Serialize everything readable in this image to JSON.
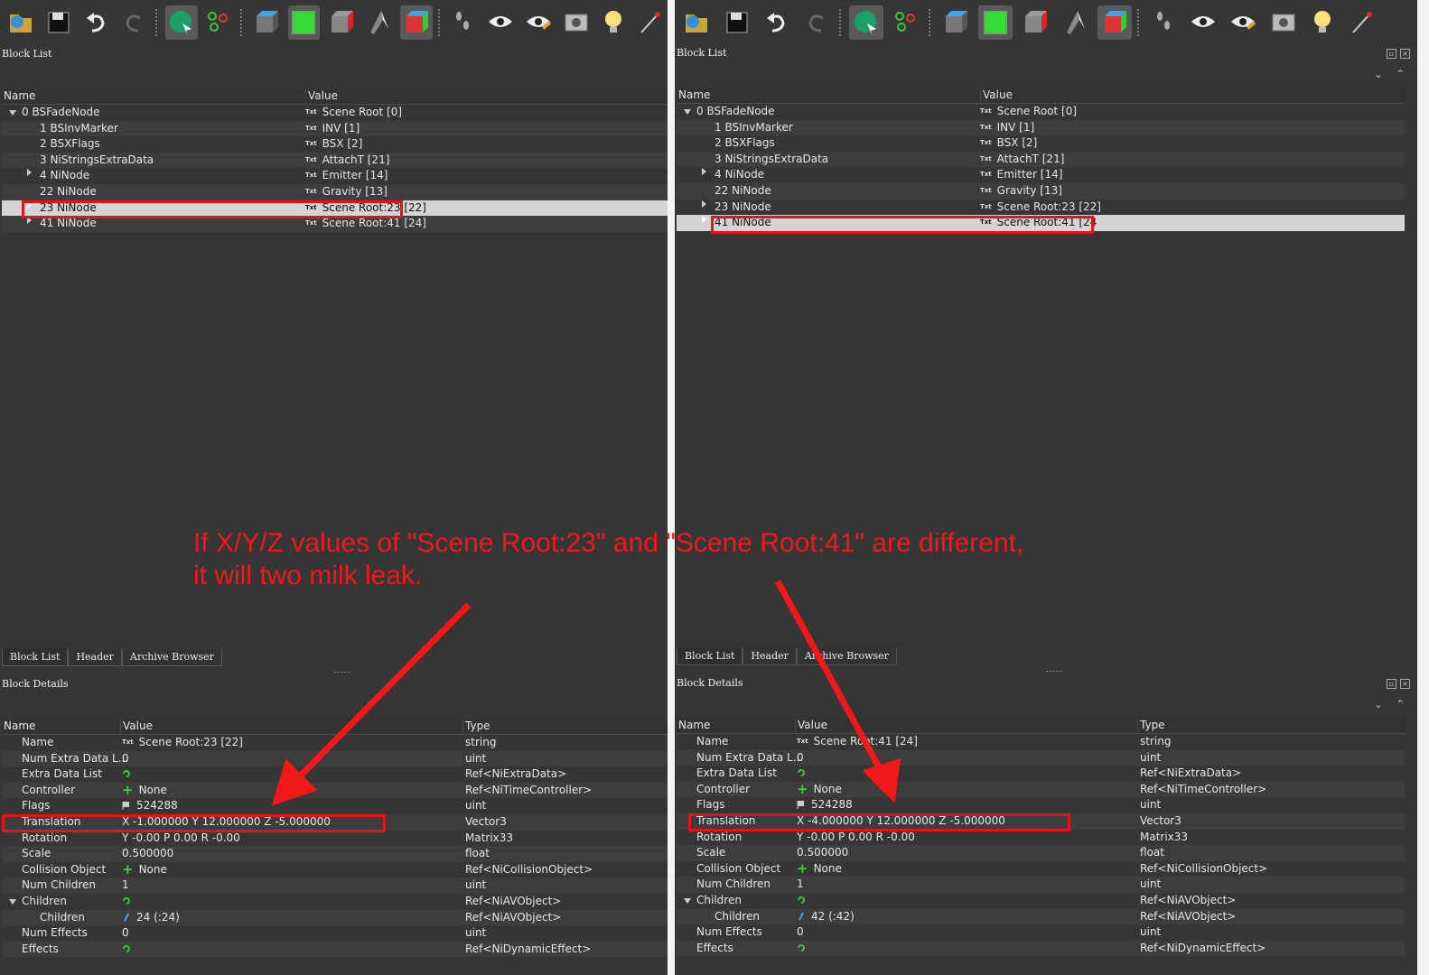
{
  "colors": {
    "highlight": "#e0161a",
    "annotation": "#f01818",
    "selection": "#d4d4d4",
    "plus": "#36d436"
  },
  "toolbar_icons": [
    "open-icon",
    "save-icon",
    "undo-icon",
    "redo-icon",
    "sphere-select-icon",
    "nodes-icon",
    "cube-blue-icon",
    "cube-green-icon",
    "cube-red-icon",
    "ribbon-icon",
    "cube-multicolor-icon",
    "footsteps-icon",
    "eye-icon",
    "eye-pencil-icon",
    "camera-icon",
    "lightbulb-icon",
    "wand-icon"
  ],
  "annotation": {
    "line1": "If X/Y/Z values of \"Scene Root:23\" and \"Scene Root:41\" are different,",
    "line2": "it will two milk leak."
  },
  "left": {
    "block_list_title": "Block List",
    "headers": {
      "name": "Name",
      "value": "Value",
      "type": "Type"
    },
    "blocks": [
      {
        "name": "0 BSFadeNode",
        "value": "Scene Root [0]"
      },
      {
        "name": "1 BSInvMarker",
        "value": "INV [1]"
      },
      {
        "name": "2 BSXFlags",
        "value": "BSX [2]"
      },
      {
        "name": "3 NiStringsExtraData",
        "value": "AttachT [21]"
      },
      {
        "name": "4 NiNode",
        "value": "Emitter [14]"
      },
      {
        "name": "22 NiNode",
        "value": "Gravity [13]"
      },
      {
        "name": "23 NiNode",
        "value": "Scene Root:23 [22]"
      },
      {
        "name": "41 NiNode",
        "value": "Scene Root:41 [24]"
      }
    ],
    "tabs": [
      "Block List",
      "Header",
      "Archive Browser"
    ],
    "details_title": "Block Details",
    "details": [
      {
        "name": "Name",
        "value": "Scene Root:23 [22]",
        "type": "string"
      },
      {
        "name": "Num Extra Data L...",
        "value": "0",
        "type": "uint"
      },
      {
        "name": "Extra Data List",
        "value": "",
        "type": "Ref<NiExtraData>"
      },
      {
        "name": "Controller",
        "value": "None",
        "type": "Ref<NiTimeController>"
      },
      {
        "name": "Flags",
        "value": "524288",
        "type": "uint"
      },
      {
        "name": "Translation",
        "value": "X -1.000000 Y 12.000000 Z -5.000000",
        "type": "Vector3"
      },
      {
        "name": "Rotation",
        "value": "Y -0.00 P 0.00 R -0.00",
        "type": "Matrix33"
      },
      {
        "name": "Scale",
        "value": "0.500000",
        "type": "float"
      },
      {
        "name": "Collision Object",
        "value": "None",
        "type": "Ref<NiCollisionObject>"
      },
      {
        "name": "Num Children",
        "value": "1",
        "type": "uint"
      },
      {
        "name": "Children",
        "value": "",
        "type": "Ref<NiAVObject>"
      },
      {
        "name": "Children",
        "value": "24 (:24)",
        "type": "Ref<NiAVObject>"
      },
      {
        "name": "Num Effects",
        "value": "0",
        "type": "uint"
      },
      {
        "name": "Effects",
        "value": "",
        "type": "Ref<NiDynamicEffect>"
      }
    ]
  },
  "right": {
    "block_list_title": "Block List",
    "headers": {
      "name": "Name",
      "value": "Value",
      "type": "Type"
    },
    "blocks": [
      {
        "name": "0 BSFadeNode",
        "value": "Scene Root [0]"
      },
      {
        "name": "1 BSInvMarker",
        "value": "INV [1]"
      },
      {
        "name": "2 BSXFlags",
        "value": "BSX [2]"
      },
      {
        "name": "3 NiStringsExtraData",
        "value": "AttachT [21]"
      },
      {
        "name": "4 NiNode",
        "value": "Emitter [14]"
      },
      {
        "name": "22 NiNode",
        "value": "Gravity [13]"
      },
      {
        "name": "23 NiNode",
        "value": "Scene Root:23 [22]"
      },
      {
        "name": "41 NiNode",
        "value": "Scene Root:41 [24"
      }
    ],
    "tabs": [
      "Block List",
      "Header",
      "Archive Browser"
    ],
    "details_title": "Block Details",
    "details": [
      {
        "name": "Name",
        "value": "Scene Root:41 [24]",
        "type": "string"
      },
      {
        "name": "Num Extra Data L...",
        "value": "0",
        "type": "uint"
      },
      {
        "name": "Extra Data List",
        "value": "",
        "type": "Ref<NiExtraData>"
      },
      {
        "name": "Controller",
        "value": "None",
        "type": "Ref<NiTimeController>"
      },
      {
        "name": "Flags",
        "value": "524288",
        "type": "uint"
      },
      {
        "name": "Translation",
        "value": "X -4.000000 Y 12.000000 Z -5.000000",
        "type": "Vector3"
      },
      {
        "name": "Rotation",
        "value": "Y -0.00 P 0.00 R -0.00",
        "type": "Matrix33"
      },
      {
        "name": "Scale",
        "value": "0.500000",
        "type": "float"
      },
      {
        "name": "Collision Object",
        "value": "None",
        "type": "Ref<NiCollisionObject>"
      },
      {
        "name": "Num Children",
        "value": "1",
        "type": "uint"
      },
      {
        "name": "Children",
        "value": "",
        "type": "Ref<NiAVObject>"
      },
      {
        "name": "Children",
        "value": "42 (:42)",
        "type": "Ref<NiAVObject>"
      },
      {
        "name": "Num Effects",
        "value": "0",
        "type": "uint"
      },
      {
        "name": "Effects",
        "value": "",
        "type": "Ref<NiDynamicEffect>"
      }
    ]
  }
}
